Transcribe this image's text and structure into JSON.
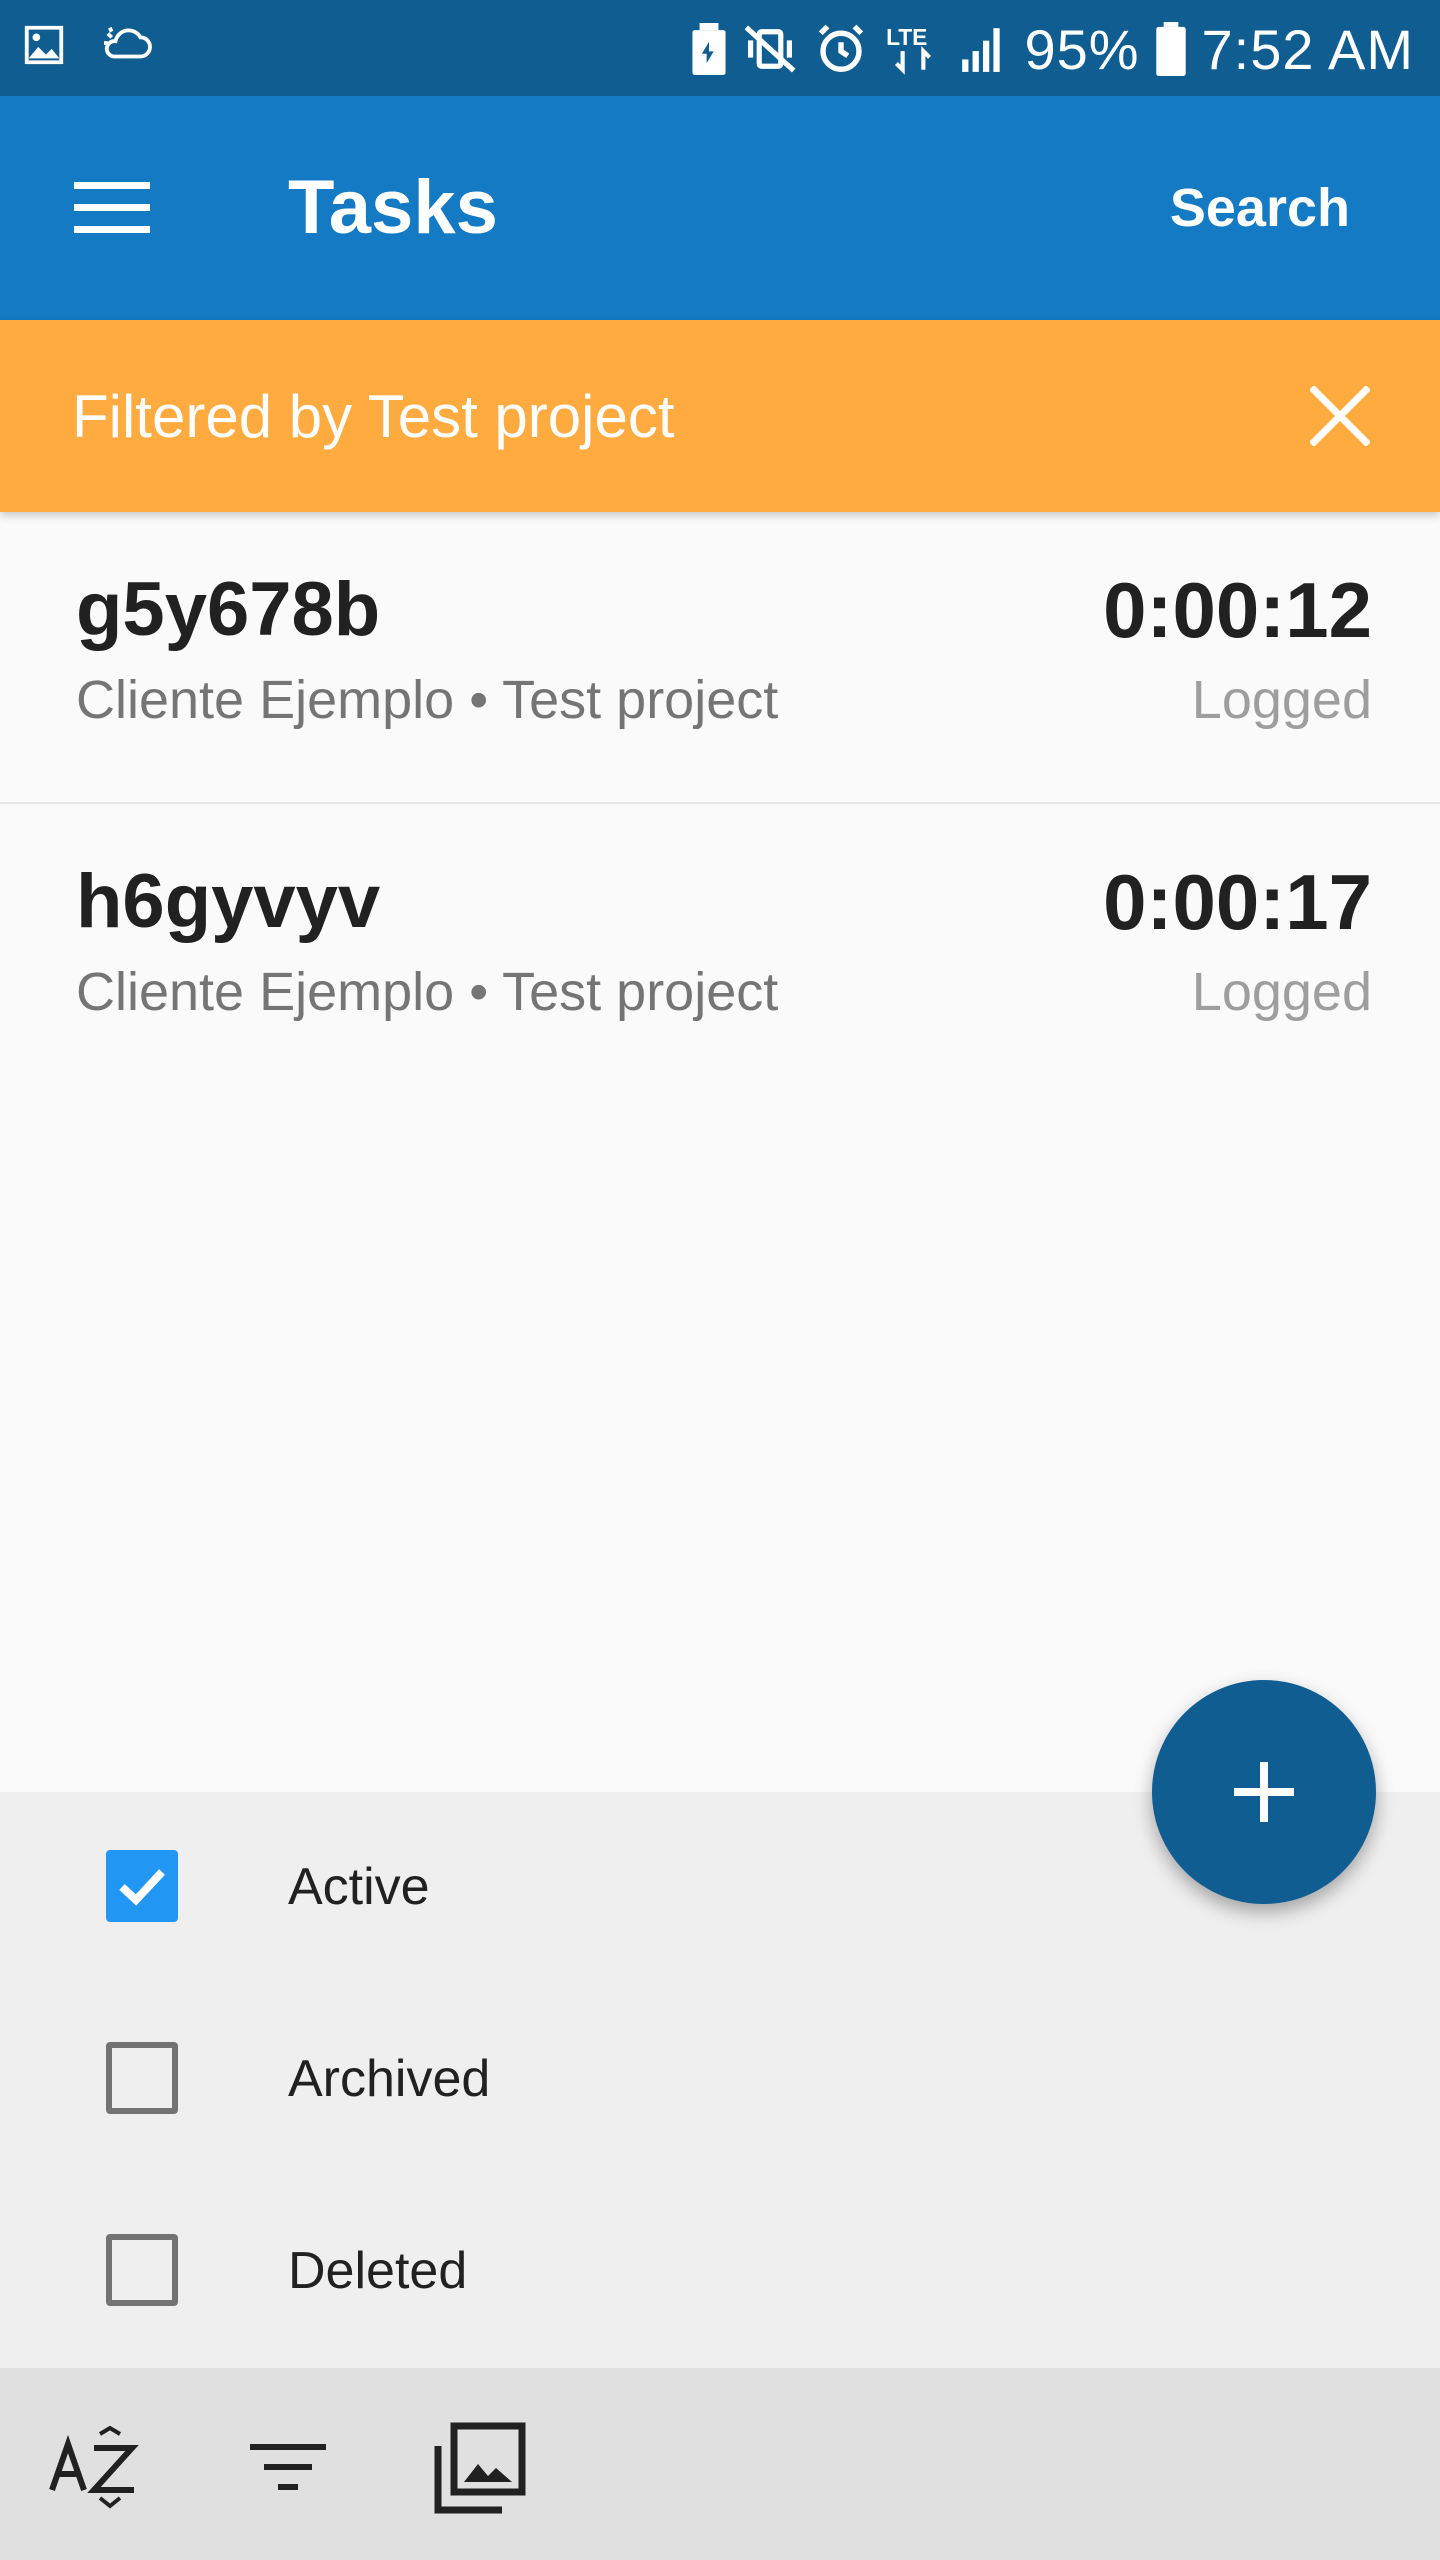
{
  "status_bar": {
    "battery": "95%",
    "time": "7:52 AM",
    "network": "LTE"
  },
  "app_bar": {
    "title": "Tasks",
    "search_label": "Search"
  },
  "filter_banner": {
    "text": "Filtered by Test project"
  },
  "tasks": [
    {
      "name": "g5y678b",
      "subtitle": "Cliente Ejemplo • Test project",
      "time": "0:00:12",
      "status": "Logged"
    },
    {
      "name": "h6gyvyv",
      "subtitle": "Cliente Ejemplo • Test project",
      "time": "0:00:17",
      "status": "Logged"
    }
  ],
  "state_filters": [
    {
      "label": "Active",
      "checked": true
    },
    {
      "label": "Archived",
      "checked": false
    },
    {
      "label": "Deleted",
      "checked": false
    }
  ],
  "colors": {
    "status_bar": "#0f5d91",
    "app_bar": "#137ac3",
    "filter_banner": "#ffab40",
    "fab": "#0f5d91",
    "checkbox_checked": "#2196f3"
  },
  "icons": {
    "menu": "hamburger-menu-icon",
    "close": "close-icon",
    "fab": "plus-icon",
    "sort": "sort-az-icon",
    "filter": "filter-list-icon",
    "gallery": "photo-library-icon"
  }
}
